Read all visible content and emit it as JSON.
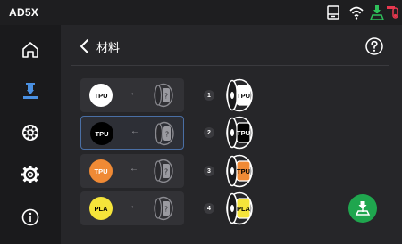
{
  "statusbar": {
    "device_name": "AD5X",
    "icons": [
      "printer-status-icon",
      "wifi-icon",
      "printing-status-icon",
      "filament-alert-icon"
    ],
    "alert_color": "#e8384f",
    "print_color": "#2fbf5a"
  },
  "sidebar": {
    "items": [
      {
        "id": "home",
        "icon": "home-icon",
        "active": false
      },
      {
        "id": "print",
        "icon": "nozzle-icon",
        "active": true
      },
      {
        "id": "material",
        "icon": "spool-icon",
        "active": false
      },
      {
        "id": "settings",
        "icon": "gear-icon",
        "active": false
      },
      {
        "id": "info",
        "icon": "info-icon",
        "active": false
      }
    ],
    "active_color": "#4a90e2"
  },
  "header": {
    "title": "材料",
    "back_icon": "chevron-left-icon",
    "help_icon": "help-icon"
  },
  "mapping": {
    "arrow": "←",
    "unknown_label": "?",
    "rows": [
      {
        "material": "TPU",
        "color": "#ffffff",
        "text_color": "#000000",
        "selected": false
      },
      {
        "material": "TPU",
        "color": "#000000",
        "text_color": "#ffffff",
        "selected": true
      },
      {
        "material": "TPU",
        "color": "#f08a35",
        "text_color": "#ffffff",
        "selected": false
      },
      {
        "material": "PLA",
        "color": "#f5e43a",
        "text_color": "#000000",
        "selected": false
      }
    ]
  },
  "slots": [
    {
      "number": "1",
      "material": "TPU",
      "color": "#ffffff",
      "text_color": "#000000"
    },
    {
      "number": "2",
      "material": "TPU",
      "color": "#000000",
      "text_color": "#ffffff"
    },
    {
      "number": "3",
      "material": "TPU",
      "color": "#f08a35",
      "text_color": "#000000"
    },
    {
      "number": "4",
      "material": "PLA",
      "color": "#f5e43a",
      "text_color": "#000000"
    }
  ],
  "actions": {
    "unload_icon": "unload-filament-icon",
    "unload_color": "#1fa64e"
  }
}
